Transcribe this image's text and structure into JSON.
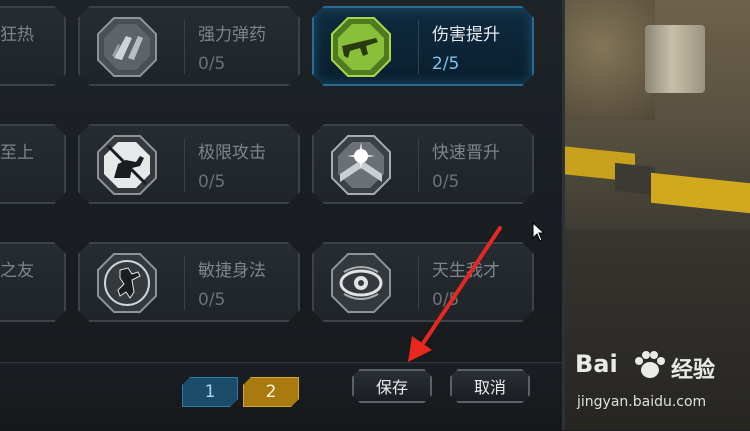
{
  "skills": {
    "row1": [
      {
        "name": "狂热",
        "partial": true
      },
      {
        "name": "强力弹药",
        "count": "0/5",
        "icon": "ammo-icon"
      },
      {
        "name": "伤害提升",
        "count": "2/5",
        "icon": "rifle-icon",
        "active": true
      }
    ],
    "row2": [
      {
        "name": "至上",
        "partial": true
      },
      {
        "name": "极限攻击",
        "count": "0/5",
        "icon": "crouch-attack-icon"
      },
      {
        "name": "快速晋升",
        "count": "0/5",
        "icon": "chevron-star-icon"
      }
    ],
    "row3": [
      {
        "name": "之友",
        "partial": true
      },
      {
        "name": "敏捷身法",
        "count": "0/5",
        "icon": "agile-soldier-icon"
      },
      {
        "name": "天生我才",
        "count": "0/5",
        "icon": "eye-icon"
      }
    ]
  },
  "pagination": {
    "page1": "1",
    "page2": "2",
    "current": 2
  },
  "actions": {
    "save": "保存",
    "cancel": "取消"
  },
  "watermark": {
    "brand": "Bai",
    "brand_cn": "经验",
    "url": "jingyan.baidu.com"
  },
  "colors": {
    "active_border": "#2b6b92",
    "active_count": "#7cc4ee",
    "page_current": "#a87a10",
    "annotation_arrow": "#e8271f"
  }
}
